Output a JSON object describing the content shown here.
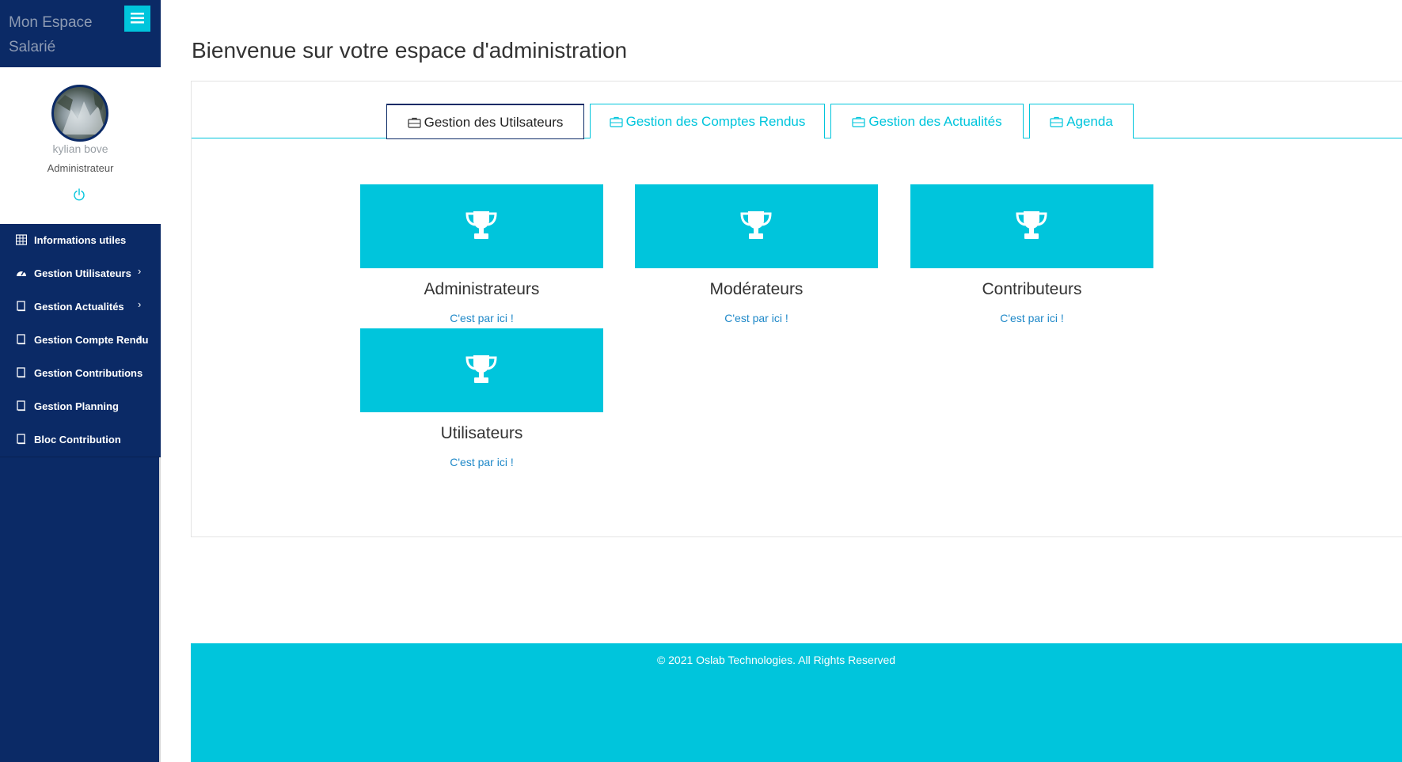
{
  "sidebar": {
    "brand_title": "Mon Espace Salarié",
    "menu_toggle_icon": "hamburger-icon",
    "profile": {
      "name": "kylian bove",
      "role": "Administrateur",
      "power_icon": "power-icon"
    },
    "items": [
      {
        "label": "Informations utiles",
        "icon": "table-icon",
        "has_submenu": false
      },
      {
        "label": "Gestion Utilisateurs",
        "icon": "dashboard-icon",
        "has_submenu": true
      },
      {
        "label": "Gestion Actualités",
        "icon": "book-icon",
        "has_submenu": true
      },
      {
        "label": "Gestion Compte Rendu",
        "icon": "book-icon",
        "has_submenu": true
      },
      {
        "label": "Gestion Contributions",
        "icon": "book-icon",
        "has_submenu": false
      },
      {
        "label": "Gestion Planning",
        "icon": "book-icon",
        "has_submenu": false
      },
      {
        "label": "Bloc Contribution",
        "icon": "book-icon",
        "has_submenu": false
      }
    ]
  },
  "main": {
    "title": "Bienvenue sur votre espace d'administration",
    "tabs": [
      {
        "label": "Gestion des Utilsateurs",
        "icon": "briefcase-icon",
        "active": true
      },
      {
        "label": "Gestion des Comptes Rendus",
        "icon": "briefcase-icon",
        "active": false
      },
      {
        "label": "Gestion des Actualités",
        "icon": "briefcase-icon",
        "active": false
      },
      {
        "label": "Agenda",
        "icon": "briefcase-icon",
        "active": false
      }
    ],
    "cards": [
      {
        "title": "Administrateurs",
        "link": "C'est par ici !",
        "icon": "trophy-icon"
      },
      {
        "title": "Modérateurs",
        "link": "C'est par ici !",
        "icon": "trophy-icon"
      },
      {
        "title": "Contributeurs",
        "link": "C'est par ici !",
        "icon": "trophy-icon"
      },
      {
        "title": "Utilisateurs",
        "link": "C'est par ici !",
        "icon": "trophy-icon"
      }
    ]
  },
  "footer": {
    "text": "© 2021 Oslab Technologies. All Rights Reserved"
  },
  "colors": {
    "sidebar_bg": "#0b2a66",
    "accent": "#00c5dc",
    "link": "#1e88c8"
  }
}
